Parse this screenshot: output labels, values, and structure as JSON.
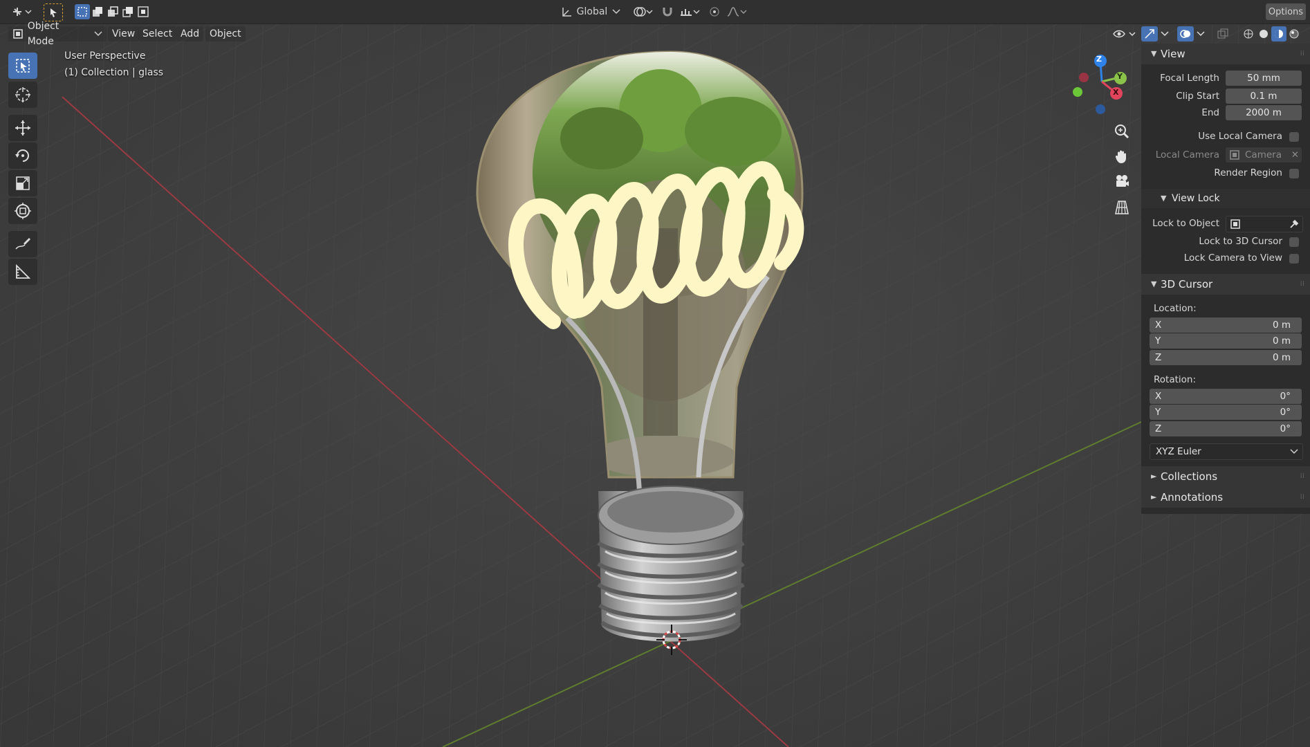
{
  "header": {
    "transform_orientation": "Global",
    "options_label": "Options"
  },
  "mode_menu": {
    "mode": "Object Mode",
    "items": [
      "View",
      "Select",
      "Add",
      "Object"
    ]
  },
  "viewport": {
    "view_name": "User Perspective",
    "collection_info": "(1) Collection | glass",
    "gizmo": {
      "x": "X",
      "y": "Y",
      "z": "Z"
    }
  },
  "sidebar": {
    "view_panel": {
      "title": "View",
      "focal_length_label": "Focal Length",
      "focal_length": "50 mm",
      "clip_start_label": "Clip Start",
      "clip_start": "0.1 m",
      "clip_end_label": "End",
      "clip_end": "2000 m",
      "use_local_camera_label": "Use Local Camera",
      "local_camera_label": "Local Camera",
      "local_camera_value": "Camera",
      "render_region_label": "Render Region"
    },
    "view_lock": {
      "title": "View Lock",
      "lock_to_object_label": "Lock to Object",
      "lock_to_cursor_label": "Lock to 3D Cursor",
      "lock_camera_label": "Lock Camera to View"
    },
    "cursor_panel": {
      "title": "3D Cursor",
      "location_label": "Location:",
      "location": [
        {
          "axis": "X",
          "value": "0 m"
        },
        {
          "axis": "Y",
          "value": "0 m"
        },
        {
          "axis": "Z",
          "value": "0 m"
        }
      ],
      "rotation_label": "Rotation:",
      "rotation": [
        {
          "axis": "X",
          "value": "0°"
        },
        {
          "axis": "Y",
          "value": "0°"
        },
        {
          "axis": "Z",
          "value": "0°"
        }
      ],
      "rotation_mode": "XYZ Euler"
    },
    "collections_title": "Collections",
    "annotations_title": "Annotations"
  },
  "colors": {
    "accent": "#4772b3",
    "axis_x": "#e2455b",
    "axis_y": "#8bc34a",
    "axis_z": "#2f83e8",
    "filament": "#fff6c6"
  }
}
